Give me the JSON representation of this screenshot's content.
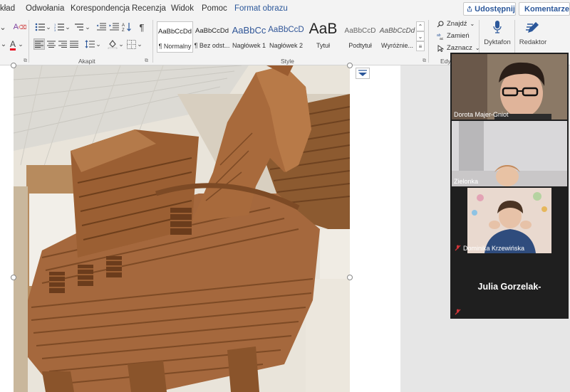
{
  "menu": {
    "items": [
      "kład",
      "Odwołania",
      "Korespondencja",
      "Recenzja",
      "Widok",
      "Pomoc",
      "Format obrazu"
    ],
    "share_label": "Udostępnij",
    "comments_label": "Komentarze"
  },
  "ribbon": {
    "paragraph_group": "Akapit",
    "styles_group": "Style",
    "editing_group": "Edy",
    "styles": [
      {
        "preview": "AaBbCcDd",
        "label": "¶ Normalny"
      },
      {
        "preview": "AaBbCcDd",
        "label": "¶ Bez odst..."
      },
      {
        "preview": "AaBbCc",
        "label": "Nagłówek 1"
      },
      {
        "preview": "AaBbCcD",
        "label": "Nagłówek 2"
      },
      {
        "preview": "AaB",
        "label": "Tytuł"
      },
      {
        "preview": "AaBbCcD",
        "label": "Podtytuł"
      },
      {
        "preview": "AaBbCcDd",
        "label": "Wyróżnie..."
      }
    ],
    "editing": {
      "find": "Znajdź",
      "replace": "Zamień",
      "select": "Zaznacz"
    },
    "dictate_label": "Dyktafon",
    "editor_label": "Redaktor"
  },
  "video_call": {
    "participants": [
      {
        "name": "Dorota Majer-Gniot",
        "muted": false
      },
      {
        "name": "Zielonka",
        "muted": false
      },
      {
        "name": "Dominika Krzewińska",
        "muted": true
      },
      {
        "name": "Julia Gorzelak-",
        "muted": true
      }
    ]
  },
  "colors": {
    "accent": "#2b579a",
    "wood": "#a5683d",
    "speaker_border": "#a4c86f",
    "mute_red": "#d13438"
  }
}
